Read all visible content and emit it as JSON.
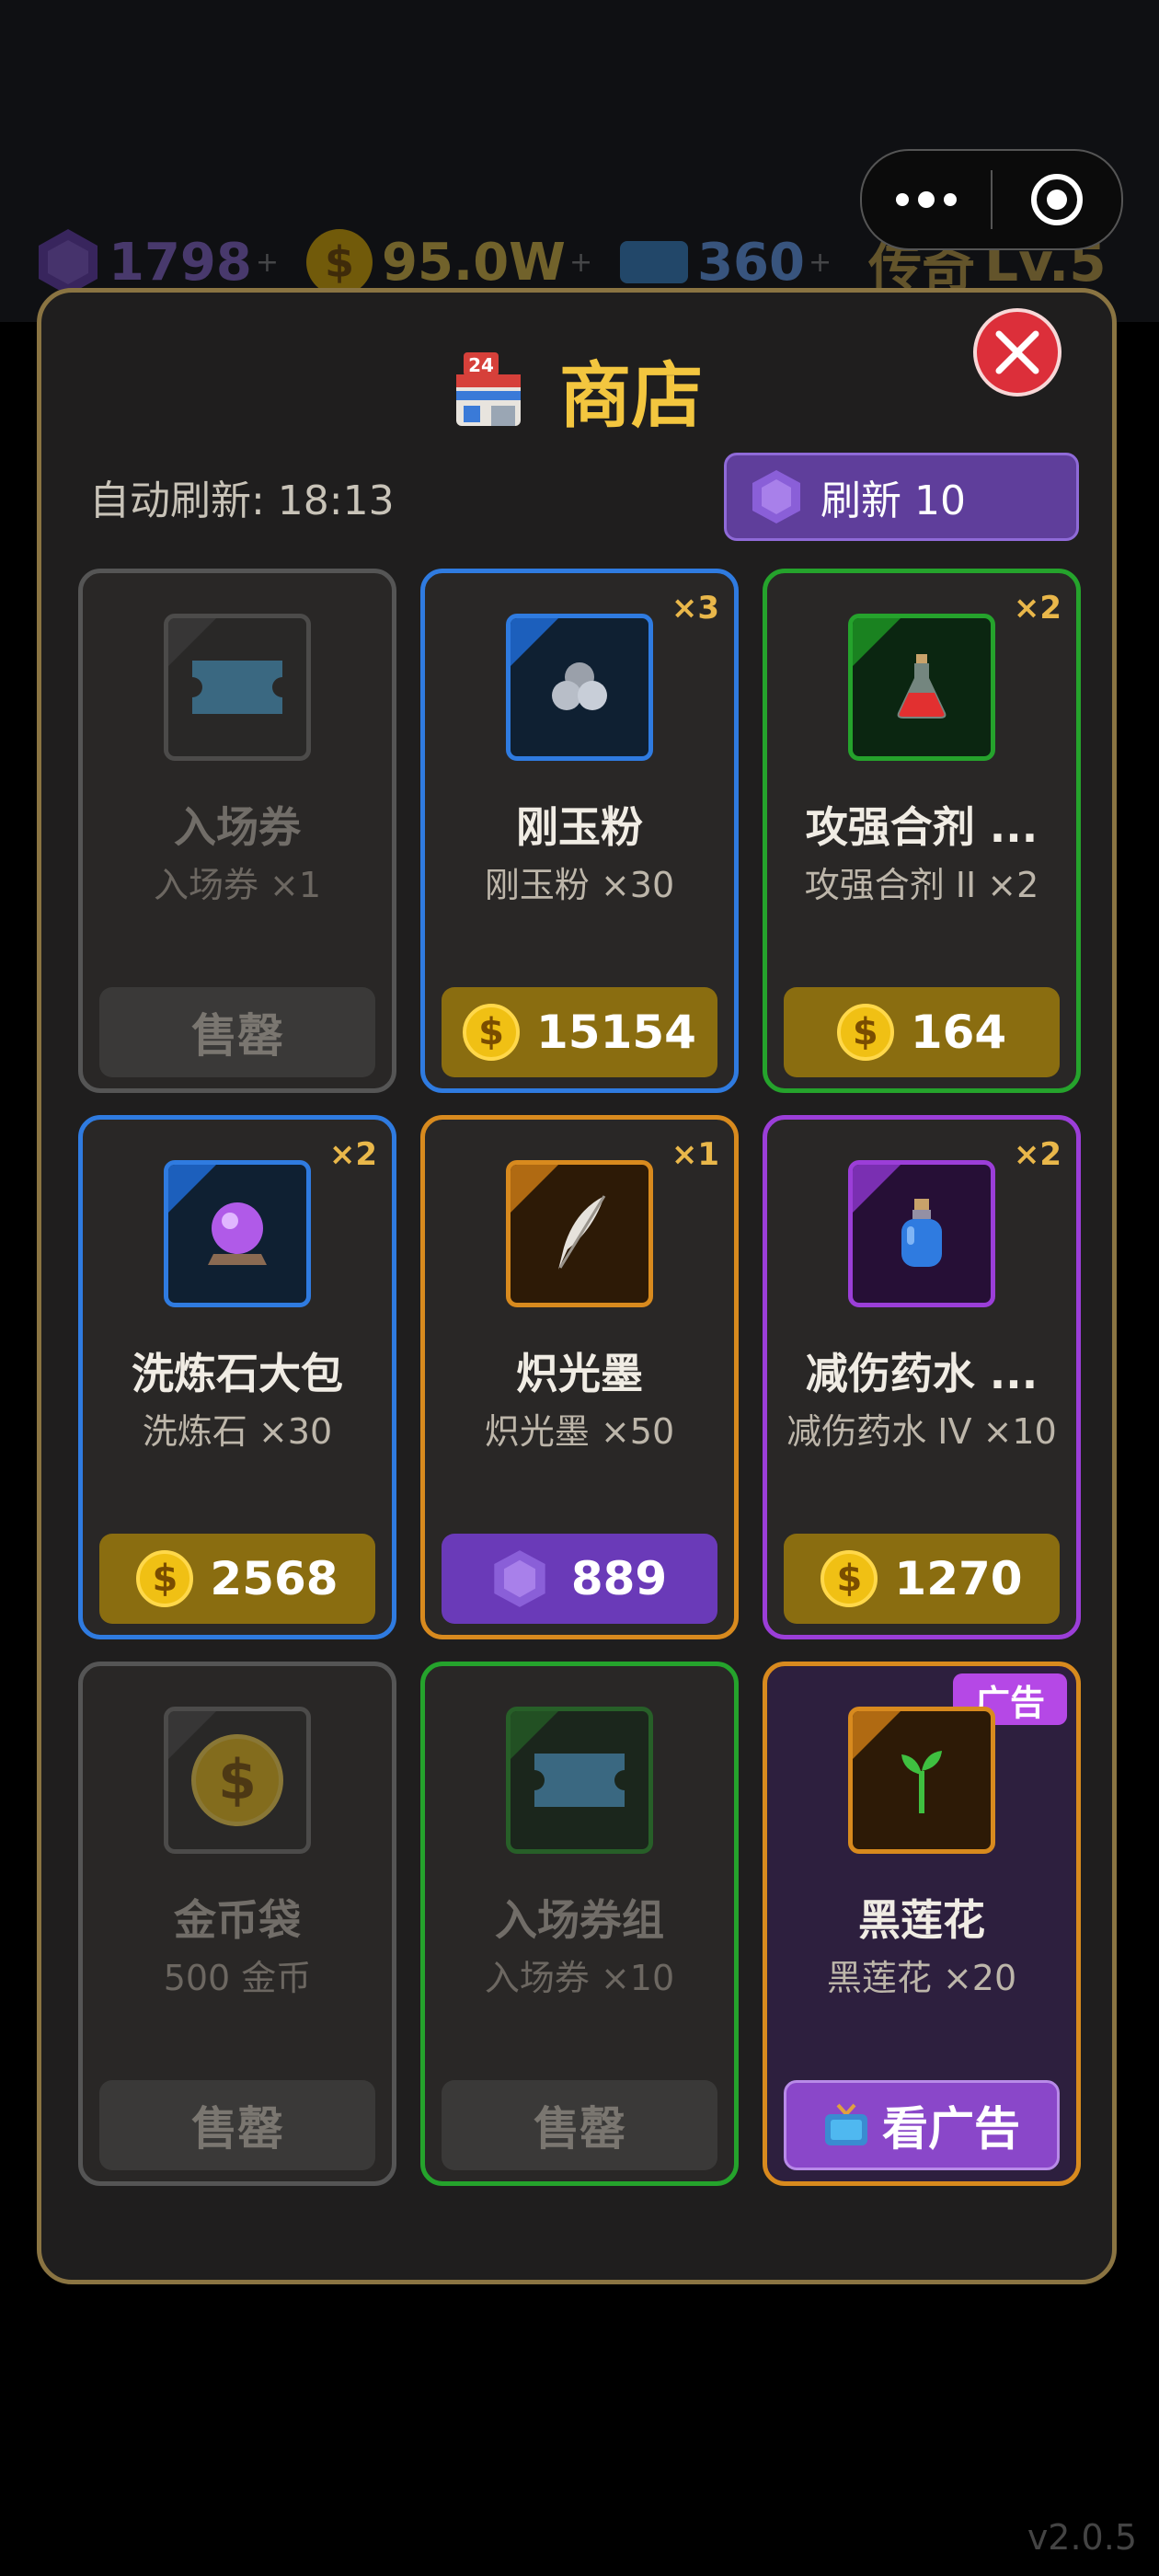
{
  "resources": {
    "gems": "1798",
    "gold": "95.0W",
    "tickets": "360",
    "plus": "+",
    "rank": "传奇",
    "level": "Lv.5"
  },
  "shop": {
    "title": "商店",
    "auto_refresh_label": "自动刷新: 18:13",
    "refresh_button": "刷新 10"
  },
  "items": [
    {
      "name": "入场券",
      "sub": "入场券 ×1",
      "qty": "",
      "button": "售罄",
      "button_type": "sold",
      "icon": "ticket-icon"
    },
    {
      "name": "刚玉粉",
      "sub": "刚玉粉 ×30",
      "qty": "×3",
      "button": "15154",
      "button_type": "gold",
      "icon": "corundum-powder-icon"
    },
    {
      "name": "攻强合剂 ...",
      "sub": "攻强合剂 II ×2",
      "qty": "×2",
      "button": "164",
      "button_type": "gold",
      "icon": "red-potion-icon"
    },
    {
      "name": "洗炼石大包",
      "sub": "洗炼石 ×30",
      "qty": "×2",
      "button": "2568",
      "button_type": "gold",
      "icon": "crystal-ball-icon"
    },
    {
      "name": "炽光墨",
      "sub": "炽光墨 ×50",
      "qty": "×1",
      "button": "889",
      "button_type": "gem",
      "icon": "feather-quill-icon"
    },
    {
      "name": "减伤药水 ...",
      "sub": "减伤药水 IV ×10",
      "qty": "×2",
      "button": "1270",
      "button_type": "gold",
      "icon": "blue-potion-icon"
    },
    {
      "name": "金币袋",
      "sub": "500 金币",
      "qty": "",
      "button": "售罄",
      "button_type": "sold",
      "icon": "gold-coin-icon"
    },
    {
      "name": "入场券组",
      "sub": "入场券 ×10",
      "qty": "",
      "button": "售罄",
      "button_type": "sold",
      "icon": "ticket-icon"
    },
    {
      "name": "黑莲花",
      "sub": "黑莲花 ×20",
      "qty": "",
      "tag": "广告",
      "button": "看广告",
      "button_type": "ad",
      "icon": "sprout-icon"
    }
  ],
  "version": "v2.0.5",
  "colors": {
    "panel_border": "#8a7442",
    "title": "#f3c63f",
    "close": "#dc2f3a",
    "rarity_blue": "#2f7be0",
    "rarity_green": "#25a32c",
    "rarity_orange": "#d88a1e",
    "rarity_purple": "#9b3ed8"
  }
}
